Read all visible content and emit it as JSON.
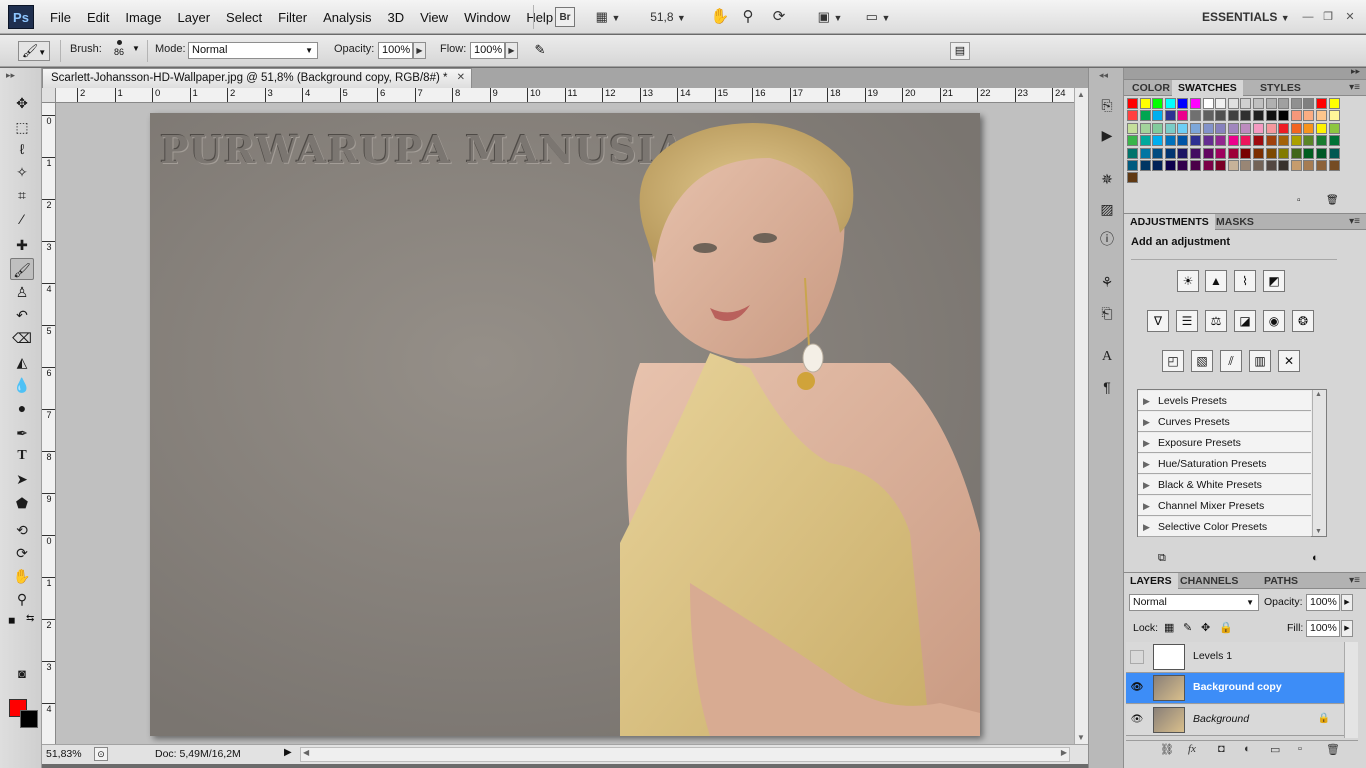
{
  "app": {
    "logo": "Ps",
    "workspace": "ESSENTIALS",
    "zoom_field": "51,8"
  },
  "menus": [
    "File",
    "Edit",
    "Image",
    "Layer",
    "Select",
    "Filter",
    "Analysis",
    "3D",
    "View",
    "Window",
    "Help"
  ],
  "bridge": "Br",
  "options": {
    "brush_label": "Brush:",
    "brush_size": "86",
    "mode_label": "Mode:",
    "mode_value": "Normal",
    "opacity_label": "Opacity:",
    "opacity_value": "100%",
    "flow_label": "Flow:",
    "flow_value": "100%"
  },
  "document": {
    "tab_title": "Scarlett-Johansson-HD-Wallpaper.jpg @ 51,8% (Background copy, RGB/8#) *",
    "overlay_text": "PURWARUPA MANUSIA",
    "zoom_status": "51,83%",
    "doc_size": "Doc: 5,49M/16,2M"
  },
  "ruler_h": [
    "2",
    "1",
    "0",
    "1",
    "2",
    "3",
    "4",
    "5",
    "6",
    "7",
    "8",
    "9",
    "10",
    "11",
    "12",
    "13",
    "14",
    "15",
    "16",
    "17",
    "18",
    "19",
    "20",
    "21",
    "22",
    "23",
    "24"
  ],
  "ruler_v": [
    "0",
    "1",
    "2",
    "3",
    "4",
    "5",
    "6",
    "7",
    "8",
    "9",
    "0",
    "1",
    "2",
    "3",
    "4"
  ],
  "panels": {
    "top_tabs": [
      "COLOR",
      "SWATCHES",
      "STYLES"
    ],
    "adj_tabs": [
      "ADJUSTMENTS",
      "MASKS"
    ],
    "adj_title": "Add an adjustment",
    "presets": [
      "Levels Presets",
      "Curves Presets",
      "Exposure Presets",
      "Hue/Saturation Presets",
      "Black & White Presets",
      "Channel Mixer Presets",
      "Selective Color Presets"
    ],
    "layer_tabs": [
      "LAYERS",
      "CHANNELS",
      "PATHS"
    ],
    "blend_mode": "Normal",
    "opacity_label": "Opacity:",
    "opacity_value": "100%",
    "lock_label": "Lock:",
    "fill_label": "Fill:",
    "fill_value": "100%",
    "layers": [
      {
        "name": "Levels 1",
        "visible": false,
        "selected": false
      },
      {
        "name": "Background copy",
        "visible": true,
        "selected": true
      },
      {
        "name": "Background",
        "visible": true,
        "selected": false
      }
    ]
  },
  "colors": {
    "foreground": "#ff0000",
    "background": "#000000",
    "selection": "#3d8df7"
  },
  "swatch_colors": [
    "#ff0000",
    "#ffff00",
    "#00ff00",
    "#00ffff",
    "#0000ff",
    "#ff00ff",
    "#ffffff",
    "#f0f0f0",
    "#e0e0e0",
    "#d0d0d0",
    "#c0c0c0",
    "#b0b0b0",
    "#a0a0a0",
    "#909090",
    "#808080",
    "#ff0000",
    "#ffff00",
    "#ff4040",
    "#00a651",
    "#00aeef",
    "#2e3192",
    "#ec008c",
    "#707070",
    "#606060",
    "#505050",
    "#404040",
    "#303030",
    "#202020",
    "#101010",
    "#000000",
    "#f7977a",
    "#fbad82",
    "#fdc68c",
    "#fff799",
    "#c4df9b",
    "#a3d39c",
    "#82ca9c",
    "#7accc8",
    "#6dcff6",
    "#7da7d9",
    "#8393ca",
    "#8781bd",
    "#a186be",
    "#bd8cbf",
    "#f49ac1",
    "#f5989d",
    "#ed1c24",
    "#f26522",
    "#f7941d",
    "#fff200",
    "#8dc63f",
    "#39b54a",
    "#00a99d",
    "#00aeef",
    "#0072bc",
    "#0054a6",
    "#2e3192",
    "#662d91",
    "#92278f",
    "#ec008c",
    "#ed145b",
    "#9e0b0f",
    "#a0410d",
    "#a36209",
    "#aba000",
    "#598527",
    "#197b30",
    "#007236",
    "#00746b",
    "#0076a3",
    "#004b80",
    "#003471",
    "#1b1464",
    "#440e62",
    "#630460",
    "#9e005d",
    "#9e0039",
    "#790000",
    "#7b2e00",
    "#7d4900",
    "#827b00",
    "#406618",
    "#005e20",
    "#005826",
    "#005952",
    "#005b7f",
    "#003663",
    "#002157",
    "#0d004c",
    "#32004b",
    "#4b0049",
    "#7b0046",
    "#7a0026",
    "#c7b299",
    "#998675",
    "#736357",
    "#534741",
    "#37302a",
    "#c69c6d",
    "#a67c52",
    "#8c6239",
    "#754c24",
    "#603913"
  ]
}
